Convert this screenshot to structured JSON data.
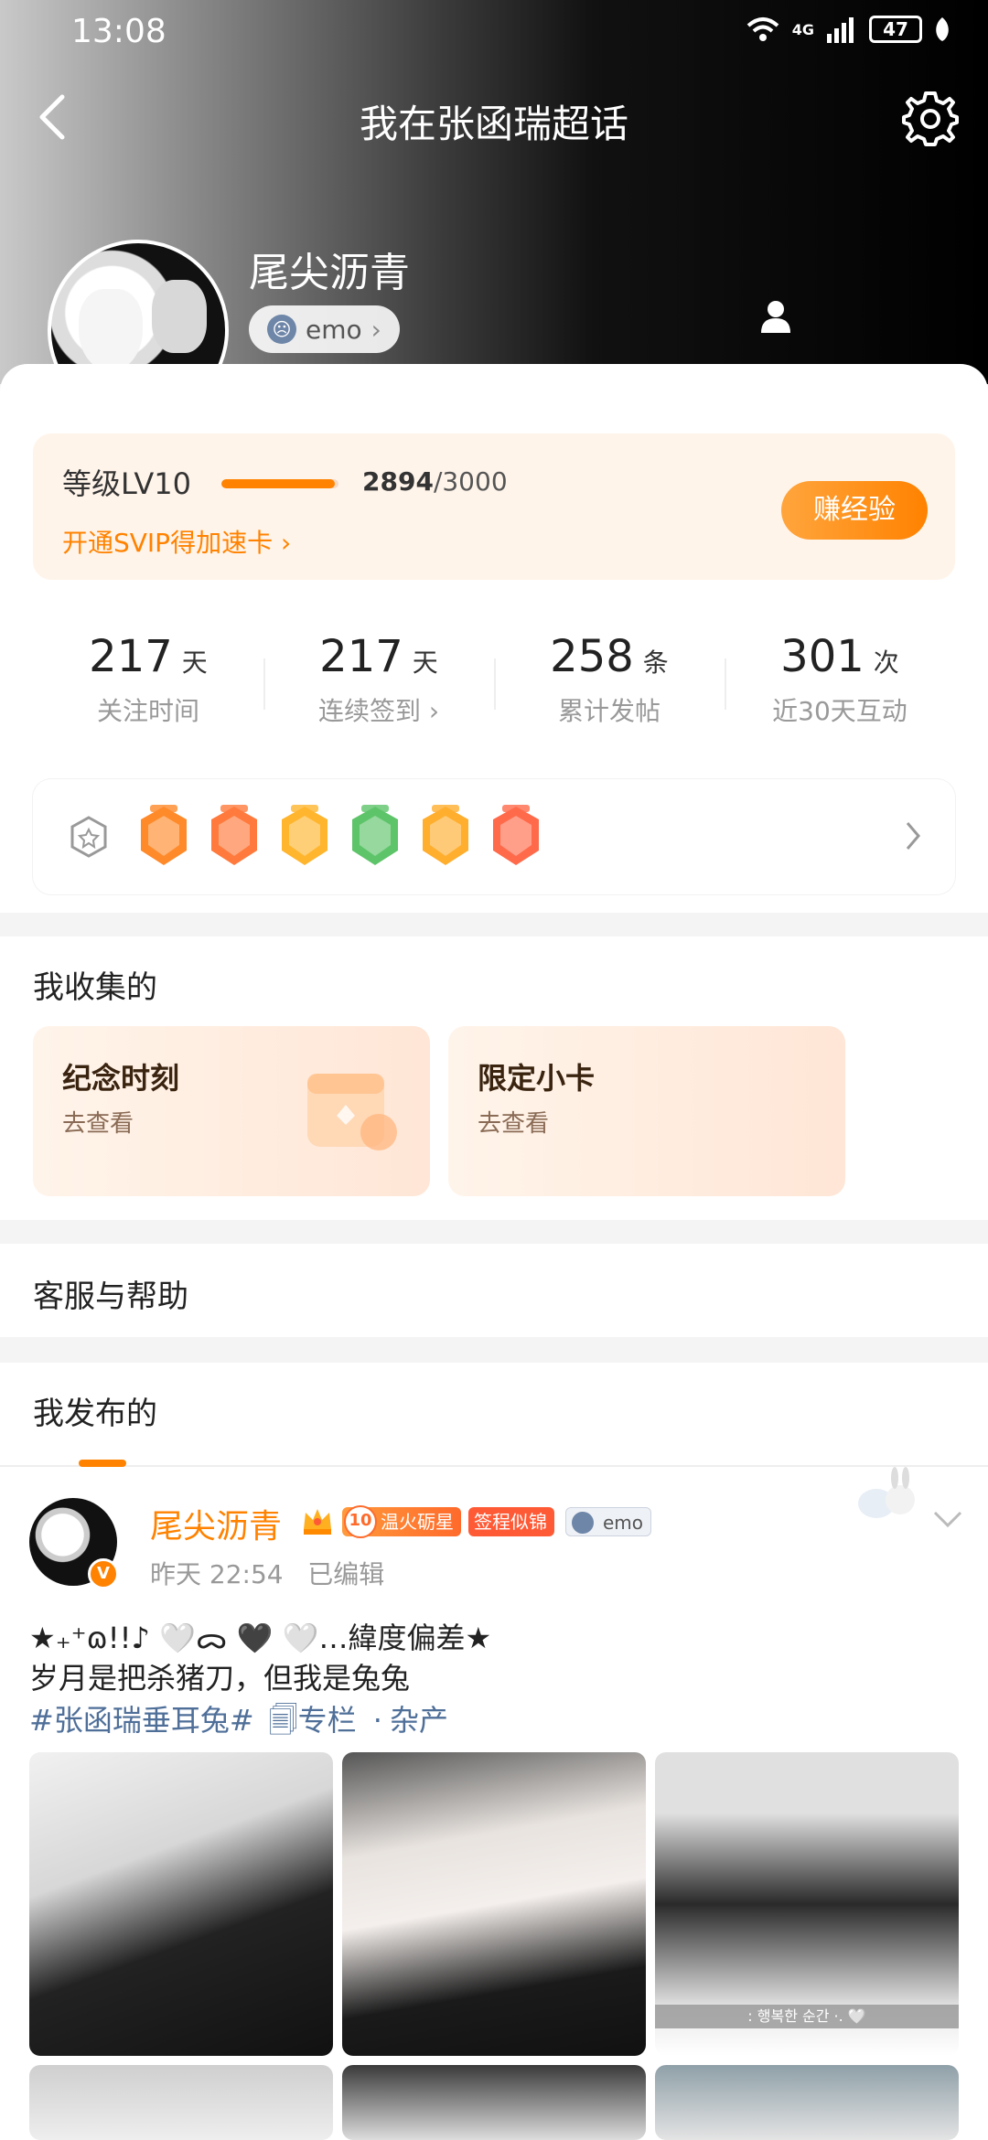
{
  "status_bar": {
    "time": "13:08",
    "network": "4G",
    "battery": "47"
  },
  "nav": {
    "title": "我在张函瑞超话"
  },
  "profile": {
    "name": "尾尖沥青",
    "verified_badge": "V",
    "mood": "emo"
  },
  "level": {
    "label": "等级LV10",
    "progress_percent": 96.5,
    "exp_current": "2894",
    "exp_total": "/3000",
    "svip_link": "开通SVIP得加速卡",
    "earn_button": "赚经验"
  },
  "stats": [
    {
      "value": "217",
      "unit": "天",
      "label": "关注时间"
    },
    {
      "value": "217",
      "unit": "天",
      "label": "连续签到"
    },
    {
      "value": "258",
      "unit": "条",
      "label": "累计发帖"
    },
    {
      "value": "301",
      "unit": "次",
      "label": "近30天互动"
    }
  ],
  "badges": {
    "icons": [
      "lv10-badge-icon",
      "100-days-badge-icon",
      "hi-badge-icon",
      "heart-badge-icon",
      "30-days-badge-icon",
      "rock-hand-badge-icon"
    ],
    "colors": [
      "#ff8a2a",
      "#ff7a3c",
      "#ffb52e",
      "#5ec46a",
      "#ffae2e",
      "#ff6a4a"
    ]
  },
  "collection": {
    "title": "我收集的",
    "cards": [
      {
        "title": "纪念时刻",
        "sub": "去查看"
      },
      {
        "title": "限定小卡",
        "sub": "去查看"
      }
    ]
  },
  "help": {
    "title": "客服与帮助"
  },
  "posts": {
    "tab_title": "我发布的",
    "item": {
      "author": "尾尖沥青",
      "level_num": "10",
      "level_tag": "温火砺星",
      "red_tag": "签程似锦",
      "mood_tag": "emo",
      "time": "昨天 22:54",
      "edited": "已编辑",
      "line1": "★₊⁺ɷ!!♪ 🤍ᯅ    🖤   🤍…緯度偏差★",
      "line2": "岁月是把杀猪刀，但我是兔兔",
      "hashtag": "#张函瑞垂耳兔#",
      "column": "专栏",
      "column_sep": "·",
      "column_name": "杂产",
      "photo3_caption": ": 행복한 순간 ·. 🤍"
    }
  },
  "colors": {
    "accent": "#ff8200",
    "link": "#4f6f99"
  }
}
